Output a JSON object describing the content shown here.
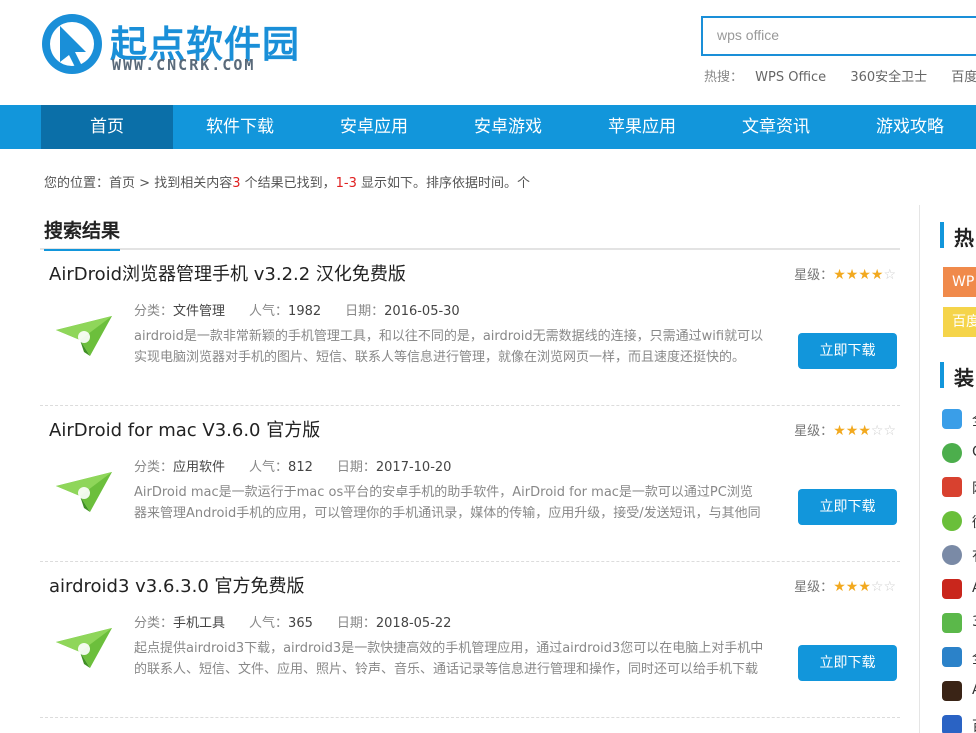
{
  "site": {
    "title": "起点软件园",
    "url_text": "WWW.CNCRK.COM"
  },
  "search": {
    "value": "wps office",
    "hot_label": "热搜：",
    "hot": [
      "WPS Office",
      "360安全卫士",
      "百度输入"
    ]
  },
  "nav": [
    "首页",
    "软件下载",
    "安卓应用",
    "安卓游戏",
    "苹果应用",
    "文章资讯",
    "游戏攻略"
  ],
  "breadcrumb": {
    "prefix": "您的位置：",
    "home": "首页",
    "sep": " > ",
    "found": "找到相关内容",
    "count": "3",
    "found2": " 个结果已找到，",
    "range": "1-3",
    "tail": " 显示如下。排序依据时间。个"
  },
  "section": {
    "title": "搜索结果"
  },
  "labels": {
    "category": "分类：",
    "popularity": "人气：",
    "date": "日期：",
    "rating": "星级：",
    "download": "立即下载"
  },
  "results": [
    {
      "title": "AirDroid浏览器管理手机 v3.2.2 汉化免费版",
      "stars": 4,
      "category": "文件管理",
      "popularity": "1982",
      "date": "2016-05-30",
      "desc": "airdroid是一款非常新颖的手机管理工具，和以往不同的是，airdroid无需数据线的连接，只需通过wifi就可以实现电脑浏览器对手机的图片、短信、联系人等信息进行管理，就像在浏览网页一样，而且速度还挺快的。"
    },
    {
      "title": "AirDroid for mac V3.6.0 官方版",
      "stars": 3,
      "category": "应用软件",
      "popularity": "812",
      "date": "2017-10-20",
      "desc": "AirDroid mac是一款运行于mac os平台的安卓手机的助手软件，AirDroid for mac是一款可以通过PC浏览器来管理Android手机的应用，可以管理你的手机通讯录，媒体的传输，应用升级，接受/发送短讯，与其他同"
    },
    {
      "title": "airdroid3 v3.6.3.0 官方免费版",
      "stars": 3,
      "category": "手机工具",
      "popularity": "365",
      "date": "2018-05-22",
      "desc": "起点提供airdroid3下载，airdroid3是一款快捷高效的手机管理应用，通过airdroid3您可以在电脑上对手机中的联系人、短信、文件、应用、照片、铃声、音乐、通话记录等信息进行管理和操作，同时还可以给手机下载"
    }
  ],
  "sidebar": {
    "hot_title": "热",
    "tags": [
      "WP",
      "百度"
    ],
    "install_title": "装",
    "apps": [
      "全",
      "C",
      "网",
      "微",
      "有",
      "A",
      "3",
      "全",
      "A",
      "百"
    ]
  },
  "colors": {
    "brand": "#1296db",
    "nav_active": "#0b6fa8",
    "star_on": "#f2a91f",
    "tag_orange": "#f08a4b",
    "tag_yellow": "#f5d44a"
  }
}
